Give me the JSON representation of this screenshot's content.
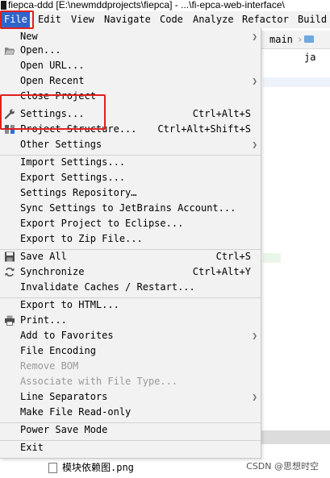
{
  "window": {
    "title": "fiepca-ddd [E:\\newmddprojects\\fiepca] - ...\\fi-epca-web-interface\\"
  },
  "menubar": {
    "items": [
      {
        "label": "File"
      },
      {
        "label": "Edit"
      },
      {
        "label": "View"
      },
      {
        "label": "Navigate"
      },
      {
        "label": "Code"
      },
      {
        "label": "Analyze"
      },
      {
        "label": "Refactor"
      },
      {
        "label": "Build"
      }
    ]
  },
  "breadcrumb": {
    "main": "main",
    "java": "ja"
  },
  "file_menu": {
    "items": [
      {
        "label": "New",
        "submenu": true
      },
      {
        "label": "Open...",
        "icon": "folder-open-icon"
      },
      {
        "label": "Open URL..."
      },
      {
        "label": "Open Recent",
        "submenu": true
      },
      {
        "label": "Close Project"
      },
      {
        "label": "Settings...",
        "shortcut": "Ctrl+Alt+S",
        "icon": "wrench-icon"
      },
      {
        "label": "Project Structure...",
        "shortcut": "Ctrl+Alt+Shift+S",
        "icon": "project-structure-icon"
      },
      {
        "label": "Other Settings",
        "submenu": true
      },
      {
        "label": "Import Settings..."
      },
      {
        "label": "Export Settings..."
      },
      {
        "label": "Settings Repository…"
      },
      {
        "label": "Sync Settings to JetBrains Account..."
      },
      {
        "label": "Export Project to Eclipse..."
      },
      {
        "label": "Export to Zip File..."
      },
      {
        "label": "Save All",
        "shortcut": "Ctrl+S",
        "icon": "save-icon"
      },
      {
        "label": "Synchronize",
        "shortcut": "Ctrl+Alt+Y",
        "icon": "sync-icon"
      },
      {
        "label": "Invalidate Caches / Restart..."
      },
      {
        "label": "Export to HTML..."
      },
      {
        "label": "Print...",
        "icon": "printer-icon"
      },
      {
        "label": "Add to Favorites",
        "submenu": true
      },
      {
        "label": "File Encoding"
      },
      {
        "label": "Remove BOM",
        "disabled": true
      },
      {
        "label": "Associate with File Type...",
        "disabled": true
      },
      {
        "label": "Line Separators",
        "submenu": true
      },
      {
        "label": "Make File Read-only"
      },
      {
        "label": "Power Save Mode"
      },
      {
        "label": "Exit"
      }
    ]
  },
  "project_tree": {
    "file_name": "模块依赖图.png"
  },
  "watermark": "CSDN @思想时空",
  "colors": {
    "menu_active": "#2f65ca",
    "highlight_box": "#e02020",
    "menu_bg": "#f2f2f2"
  }
}
